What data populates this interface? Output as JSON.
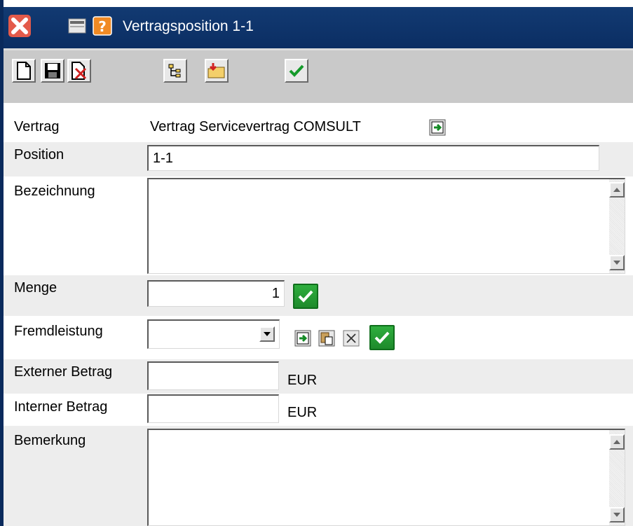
{
  "window": {
    "title": "Vertragsposition 1-1"
  },
  "titlebar_icons": [
    "close-icon",
    "minimize-icon",
    "help-icon"
  ],
  "toolbar": {
    "buttons": [
      "new-document-icon",
      "save-icon",
      "delete-icon",
      "tree-view-icon",
      "open-folder-icon",
      "confirm-check-icon"
    ]
  },
  "form": {
    "vertrag": {
      "label": "Vertrag",
      "value": "Vertrag Servicevertrag COMSULT"
    },
    "position": {
      "label": "Position",
      "value": "1-1"
    },
    "bezeichnung": {
      "label": "Bezeichnung",
      "value": ""
    },
    "menge": {
      "label": "Menge",
      "value": "1"
    },
    "fremdleistung": {
      "label": "Fremdleistung",
      "value": ""
    },
    "externer_betrag": {
      "label": "Externer Betrag",
      "value": "",
      "currency": "EUR"
    },
    "interner_betrag": {
      "label": "Interner Betrag",
      "value": "",
      "currency": "EUR"
    },
    "bemerkung": {
      "label": "Bemerkung",
      "value": ""
    }
  },
  "colors": {
    "titlebar": "#0b2e63",
    "toolbar": "#c9c9c9",
    "row_alt": "#ededed",
    "accept_green": "#2fae3e"
  }
}
